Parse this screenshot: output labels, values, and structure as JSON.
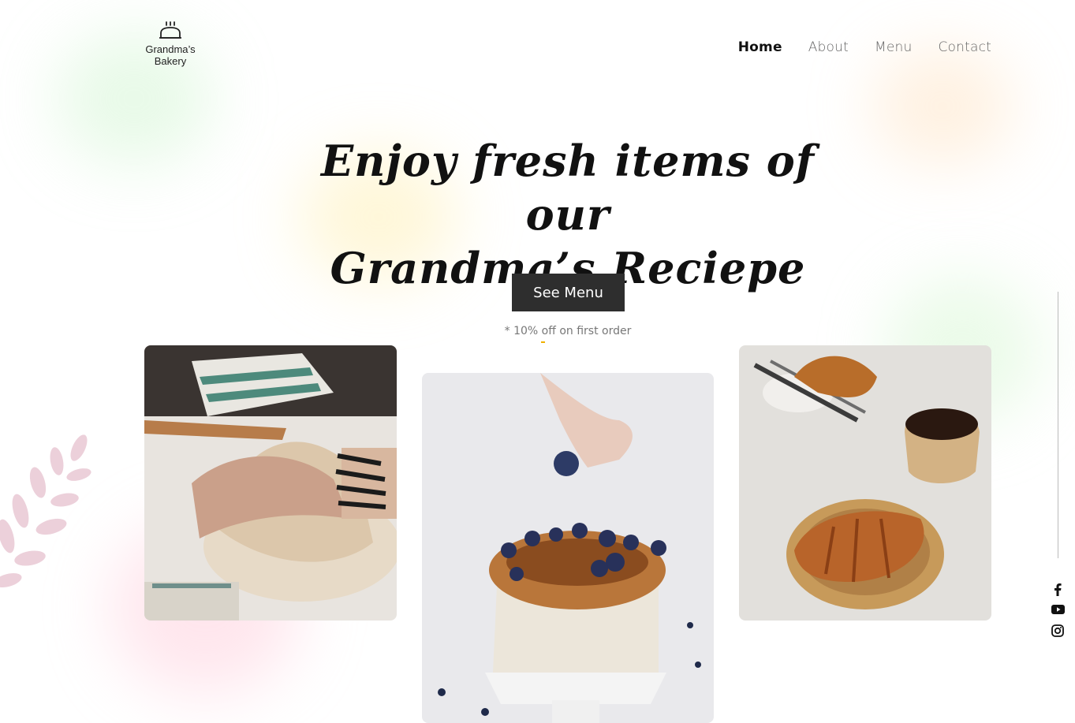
{
  "brand": {
    "name_line1": "Grandma’s",
    "name_line2": "Bakery",
    "logo_icon": "bread-icon"
  },
  "nav": {
    "items": [
      {
        "label": "Home",
        "active": true
      },
      {
        "label": "About",
        "active": false
      },
      {
        "label": "Menu",
        "active": false
      },
      {
        "label": "Contact",
        "active": false
      }
    ]
  },
  "hero": {
    "title_line1": "Enjoy fresh items of our",
    "title_line2": "Grandma’s Reciepe",
    "cta_label": "See Menu",
    "offer_text": "* 10% off on first order"
  },
  "gallery": [
    {
      "subject": "hands kneading dough"
    },
    {
      "subject": "blueberry cake"
    },
    {
      "subject": "croissants with coffee"
    }
  ],
  "social": {
    "icons": [
      "facebook-icon",
      "youtube-icon",
      "instagram-icon"
    ]
  },
  "colors": {
    "button_bg": "#2e2e2e",
    "text_primary": "#111111",
    "text_muted": "#777777",
    "accent_dash": "#f0b000"
  }
}
